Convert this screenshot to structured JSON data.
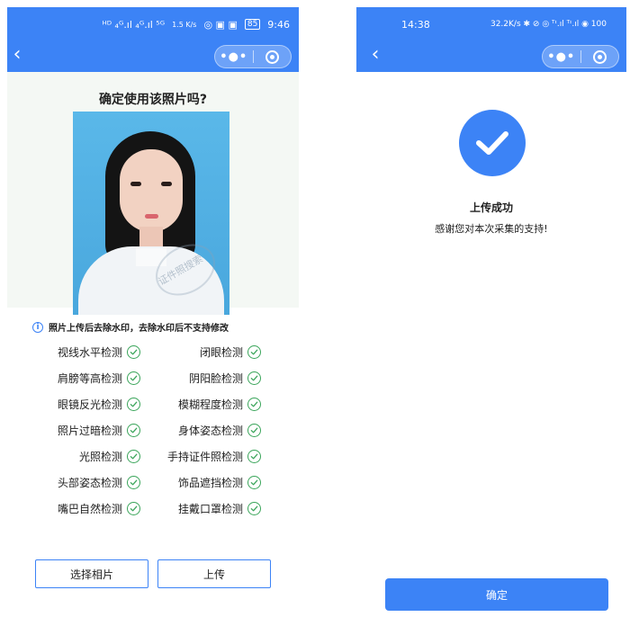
{
  "left": {
    "status": {
      "signal": "ᴴᴰ ₄ᴳ.ıl ₄ᴳ.ıl ⁵ᴳ",
      "speed": "1.5 K/s",
      "icons": "◎ ▣ ▣",
      "battery": "85",
      "time": "9:46"
    },
    "title": "确定使用该照片吗?",
    "watermark": "证件照搜索",
    "notice": "照片上传后去除水印，去除水印后不支持修改",
    "checks": [
      {
        "left": "视线水平检测",
        "right": "闭眼检测"
      },
      {
        "left": "肩膀等高检测",
        "right": "阴阳脸检测"
      },
      {
        "left": "眼镜反光检测",
        "right": "模糊程度检测"
      },
      {
        "left": "照片过暗检测",
        "right": "身体姿态检测"
      },
      {
        "left": "光照检测",
        "right": "手持证件照检测"
      },
      {
        "left": "头部姿态检测",
        "right": "饰品遮挡检测"
      },
      {
        "left": "嘴巴自然检测",
        "right": "挂戴口罩检测"
      }
    ],
    "buttons": {
      "select": "选择相片",
      "upload": "上传"
    }
  },
  "right": {
    "status": {
      "time": "14:38",
      "speed": "32.2K/s",
      "icons": "✱ ⊘ ◎ ᵀᶦ.ıl ᵀᶦ.ıl ◉ 100"
    },
    "success_title": "上传成功",
    "success_message": "感谢您对本次采集的支持!",
    "confirm": "确定"
  },
  "capsule_dots": "•●•",
  "back_glyph": "‹",
  "colors": {
    "primary": "#3c83f6",
    "success": "#3aa55a"
  },
  "icons": [
    "back-arrow-icon",
    "more-dots-icon",
    "close-mini-program-icon",
    "info-icon",
    "check-circle-icon",
    "success-check-icon"
  ]
}
